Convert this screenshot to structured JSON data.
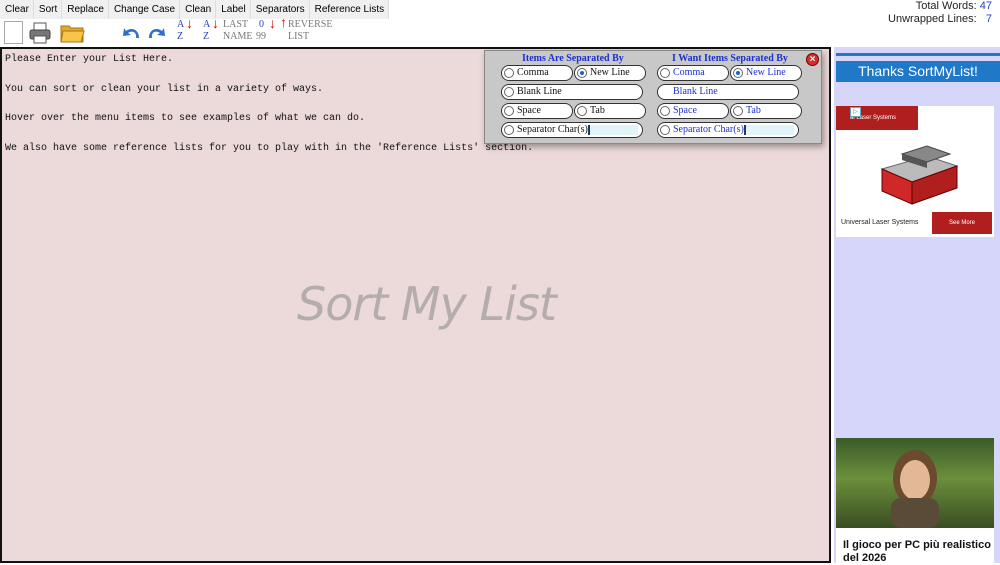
{
  "menu": [
    "Clear",
    "Sort",
    "Replace",
    "Change Case",
    "Clean",
    "Label",
    "Separators",
    "Reference Lists"
  ],
  "stats": {
    "words_label": "Total Words:",
    "words_value": "47",
    "lines_label": "Unwrapped Lines:",
    "lines_value": "7"
  },
  "toolbar": {
    "sort_az_top": "A",
    "sort_az_bottom": "Z",
    "sort_za_top": "A",
    "sort_za_bottom": "Z",
    "last_name_top": "LAST",
    "last_name_bottom": "NAME",
    "num_top": "0",
    "num_bottom": "99",
    "reverse_top": "REVERSE",
    "reverse_bottom": "LIST"
  },
  "editor": {
    "lines": [
      "Please Enter your List Here.",
      "You can sort or clean your list in a variety of ways.",
      "Hover over the menu items to see examples of what we can do.",
      "We also have some reference lists for you to play with in the 'Reference Lists' section."
    ],
    "watermark": "Sort My List"
  },
  "dialog": {
    "left_title": "Items Are Separated By",
    "right_title": "I Want Items Separated By",
    "options": [
      "Comma",
      "New Line",
      "Blank Line",
      "Space",
      "Tab",
      "Separator Char(s)"
    ],
    "left_selected": "New Line",
    "right_selected": "New Line"
  },
  "sidebar": {
    "banner": "Thanks SortMyList!",
    "ad1_brand": "al Laser Systems",
    "ad1_caption": "Universal Laser Systems",
    "ad1_button": "See More",
    "ad2_title": "Il gioco per PC più realistico del 2026"
  },
  "colors": {
    "editor_bg": "#ecd9d9",
    "accent_blue": "#1f78c8",
    "dialog_title": "#1d2fd0",
    "sidebar_bg": "#d6d6fb"
  }
}
